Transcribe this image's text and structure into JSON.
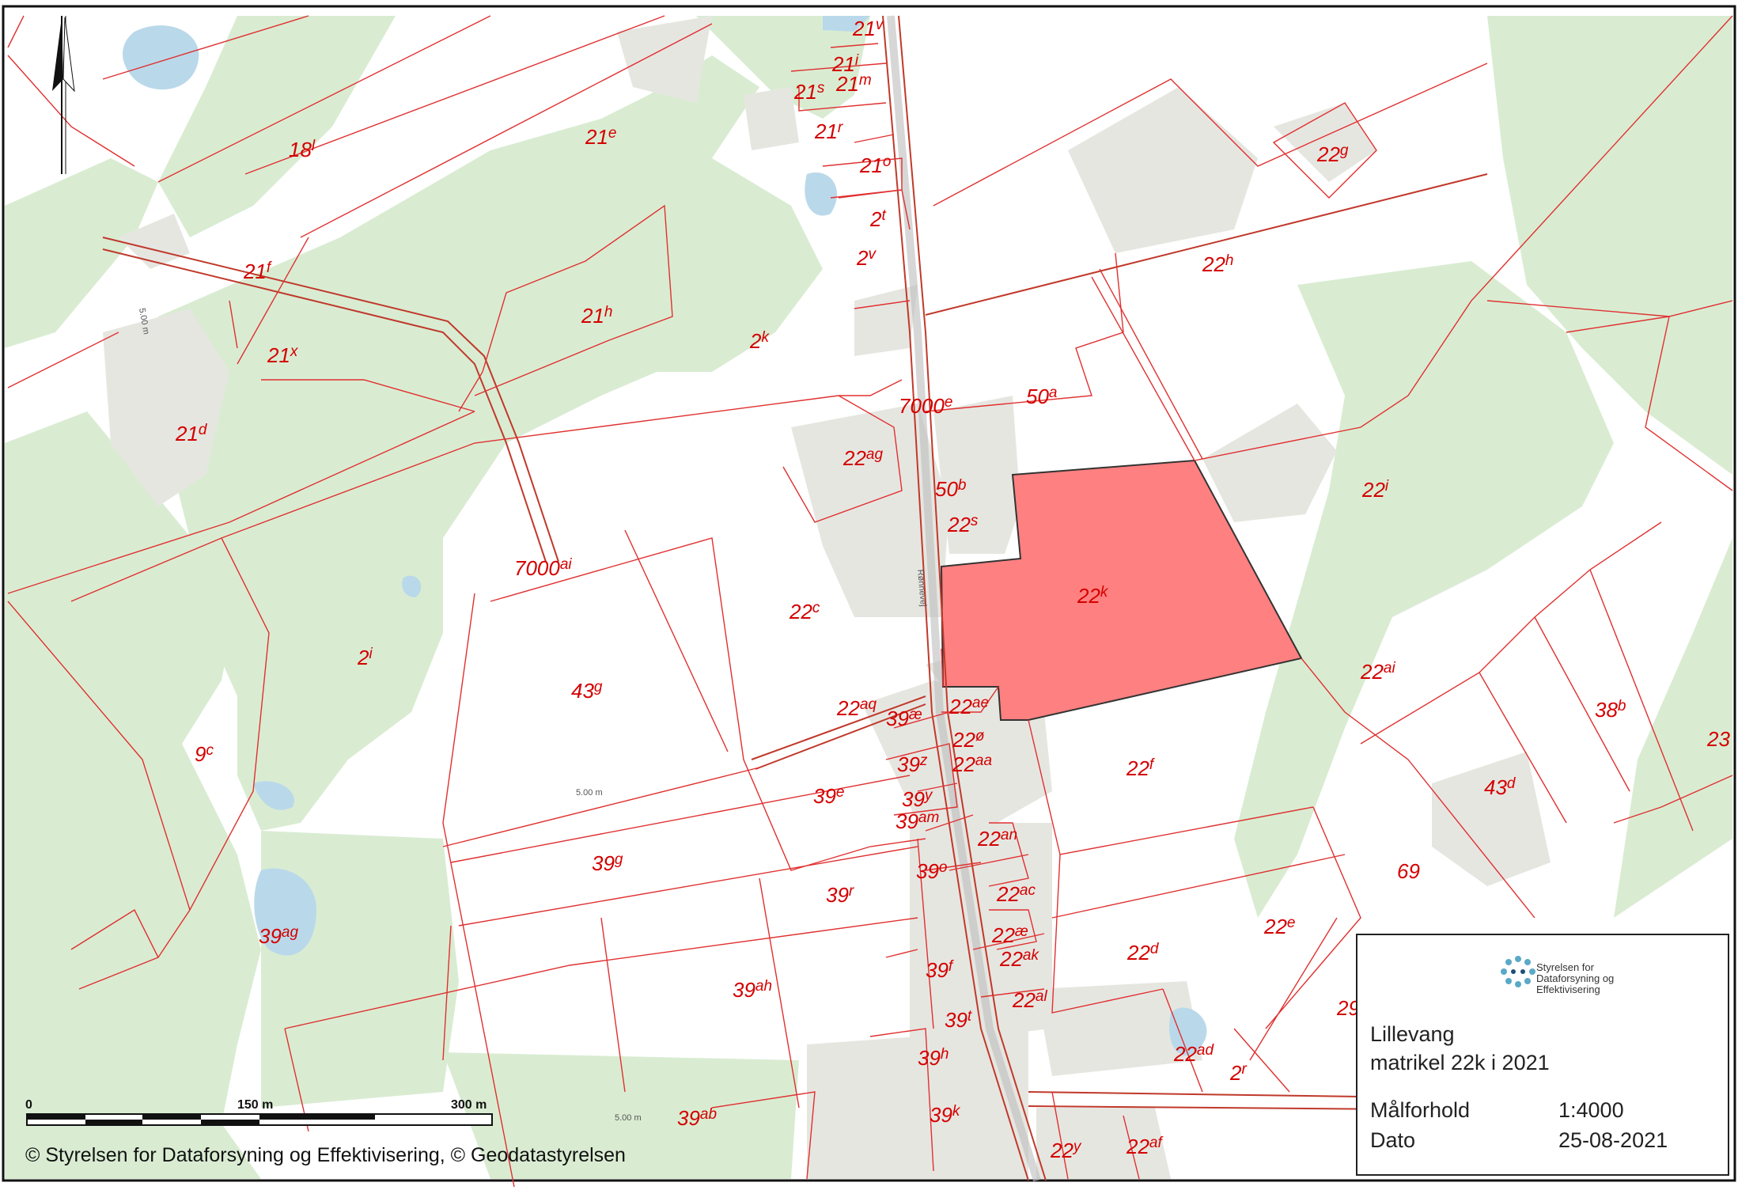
{
  "map": {
    "copyright": "© Styrelsen for Dataforsyning og Effektivisering, © Geodatastyrelsen",
    "scale_ticks": [
      "0",
      "150 m",
      "300 m"
    ],
    "highlight_parcel": "22k",
    "colors": {
      "forest": "#d9ecd2",
      "built": "#e6e6e1",
      "water": "#b9d9ea",
      "parcel_line": "#e03030",
      "highlight": "#ff8080",
      "label": "#d40000"
    },
    "parcels": [
      {
        "main": "21",
        "sup": "v"
      },
      {
        "main": "21",
        "sup": "i"
      },
      {
        "main": "21",
        "sup": "s"
      },
      {
        "main": "21",
        "sup": "m"
      },
      {
        "main": "18",
        "sup": "l"
      },
      {
        "main": "21",
        "sup": "e"
      },
      {
        "main": "21",
        "sup": "r"
      },
      {
        "main": "21",
        "sup": "o"
      },
      {
        "main": "22",
        "sup": "g"
      },
      {
        "main": "2",
        "sup": "t"
      },
      {
        "main": "2",
        "sup": "v"
      },
      {
        "main": "21",
        "sup": "f"
      },
      {
        "main": "22",
        "sup": "h"
      },
      {
        "main": "21",
        "sup": "h"
      },
      {
        "main": "21",
        "sup": "x"
      },
      {
        "main": "2",
        "sup": "k"
      },
      {
        "main": "21",
        "sup": "d"
      },
      {
        "main": "7000",
        "sup": "e"
      },
      {
        "main": "50",
        "sup": "a"
      },
      {
        "main": "22",
        "sup": "ag"
      },
      {
        "main": "50",
        "sup": "b"
      },
      {
        "main": "22",
        "sup": "i"
      },
      {
        "main": "22",
        "sup": "s"
      },
      {
        "main": "7000",
        "sup": "ai"
      },
      {
        "main": "22",
        "sup": "k"
      },
      {
        "main": "22",
        "sup": "c"
      },
      {
        "main": "2",
        "sup": "i"
      },
      {
        "main": "43",
        "sup": "g"
      },
      {
        "main": "22",
        "sup": "ai"
      },
      {
        "main": "22",
        "sup": "aq"
      },
      {
        "main": "39",
        "sup": "æ"
      },
      {
        "main": "22",
        "sup": "ae"
      },
      {
        "main": "38",
        "sup": "b"
      },
      {
        "main": "23",
        "sup": ""
      },
      {
        "main": "9",
        "sup": "c"
      },
      {
        "main": "22",
        "sup": "ø"
      },
      {
        "main": "39",
        "sup": "z"
      },
      {
        "main": "22",
        "sup": "aa"
      },
      {
        "main": "22",
        "sup": "f"
      },
      {
        "main": "43",
        "sup": "d"
      },
      {
        "main": "39",
        "sup": "e"
      },
      {
        "main": "39",
        "sup": "y"
      },
      {
        "main": "39",
        "sup": "am"
      },
      {
        "main": "22",
        "sup": "an"
      },
      {
        "main": "39",
        "sup": "g"
      },
      {
        "main": "39",
        "sup": "o"
      },
      {
        "main": "69",
        "sup": ""
      },
      {
        "main": "39",
        "sup": "r"
      },
      {
        "main": "22",
        "sup": "ac"
      },
      {
        "main": "22",
        "sup": "e"
      },
      {
        "main": "39",
        "sup": "ag"
      },
      {
        "main": "22",
        "sup": "æ"
      },
      {
        "main": "22",
        "sup": "d"
      },
      {
        "main": "22",
        "sup": "ak"
      },
      {
        "main": "39",
        "sup": "f"
      },
      {
        "main": "39",
        "sup": "ah"
      },
      {
        "main": "22",
        "sup": "al"
      },
      {
        "main": "29",
        "sup": ""
      },
      {
        "main": "39",
        "sup": "t"
      },
      {
        "main": "22",
        "sup": "ad"
      },
      {
        "main": "39",
        "sup": "h"
      },
      {
        "main": "2",
        "sup": "r"
      },
      {
        "main": "39",
        "sup": "k"
      },
      {
        "main": "39",
        "sup": "ab"
      },
      {
        "main": "22",
        "sup": "y"
      },
      {
        "main": "22",
        "sup": "af"
      }
    ],
    "road_labels": [
      "5.00 m",
      "5.00 m",
      "5.00 m",
      "Rønnevej"
    ]
  },
  "infobox": {
    "agency": "Styrelsen for Dataforsyning og Effektivisering",
    "title": "Lillevang",
    "subtitle": "matrikel 22k i 2021",
    "scale_label": "Målforhold",
    "scale_value": "1:4000",
    "date_label": "Dato",
    "date_value": "25-08-2021"
  }
}
